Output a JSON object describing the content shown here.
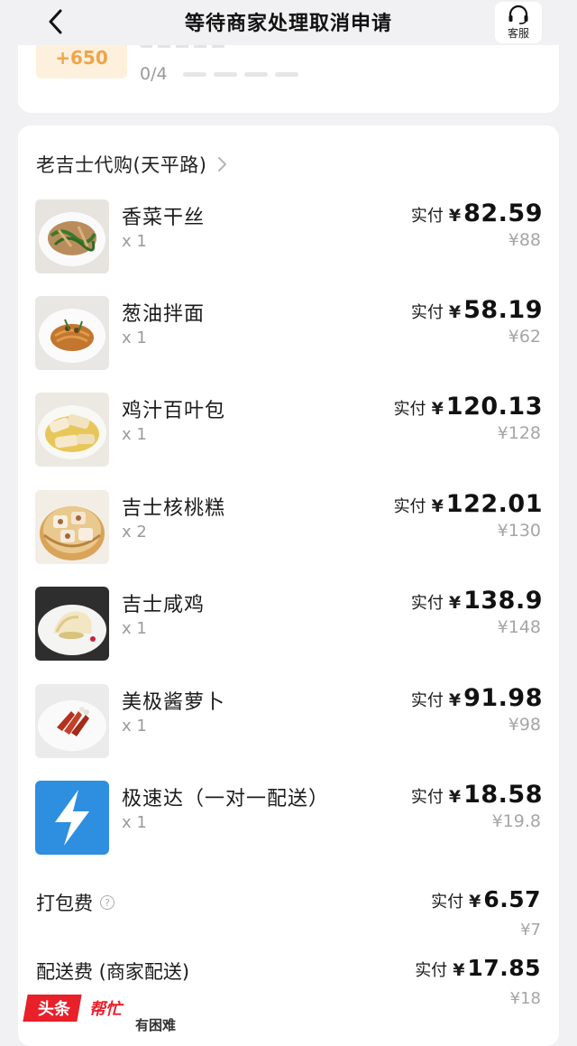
{
  "header": {
    "title": "等待商家处理取消申请",
    "customer_service_label": "客服"
  },
  "top_card": {
    "points_badge": "+650",
    "progress_text": "0/4"
  },
  "shop": {
    "name": "老吉士代购(天平路)"
  },
  "price_label": "实付",
  "currency": "¥",
  "items": [
    {
      "name": "香菜干丝",
      "qty": "x 1",
      "paid": "82.59",
      "original": "¥88",
      "thumb_icon": "dish-shredded-tofu-icon"
    },
    {
      "name": "葱油拌面",
      "qty": "x 1",
      "paid": "58.19",
      "original": "¥62",
      "thumb_icon": "dish-scallion-noodles-icon"
    },
    {
      "name": "鸡汁百叶包",
      "qty": "x 1",
      "paid": "120.13",
      "original": "¥128",
      "thumb_icon": "dish-tofu-skin-rolls-icon"
    },
    {
      "name": "吉士核桃糕",
      "qty": "x 2",
      "paid": "122.01",
      "original": "¥130",
      "thumb_icon": "dish-walnut-cake-icon"
    },
    {
      "name": "吉士咸鸡",
      "qty": "x 1",
      "paid": "138.9",
      "original": "¥148",
      "thumb_icon": "dish-salted-chicken-icon"
    },
    {
      "name": "美极酱萝卜",
      "qty": "x 1",
      "paid": "91.98",
      "original": "¥98",
      "thumb_icon": "dish-pickled-radish-icon"
    },
    {
      "name": "极速达（一对一配送）",
      "qty": "x 1",
      "paid": "18.58",
      "original": "¥19.8",
      "thumb_icon": "lightning-icon"
    }
  ],
  "fees": {
    "packing": {
      "label": "打包费",
      "help_icon": "?",
      "price_label": "实付",
      "paid": "6.57",
      "original": "¥7"
    },
    "delivery": {
      "label": "配送费 (商家配送)",
      "price_label": "实付",
      "paid": "17.85",
      "original": "¥18"
    }
  },
  "watermark": {
    "brand_red": "头条",
    "brand_white": "帮忙",
    "sub": "有困难"
  },
  "colors": {
    "page_bg": "#f1f1f3",
    "card_bg": "#ffffff",
    "badge_bg": "#fdf0dc",
    "badge_text": "#f0a44a",
    "muted": "#a6a6a6",
    "lightning_bg": "#2e8ee0",
    "watermark_red": "#e8202a"
  }
}
